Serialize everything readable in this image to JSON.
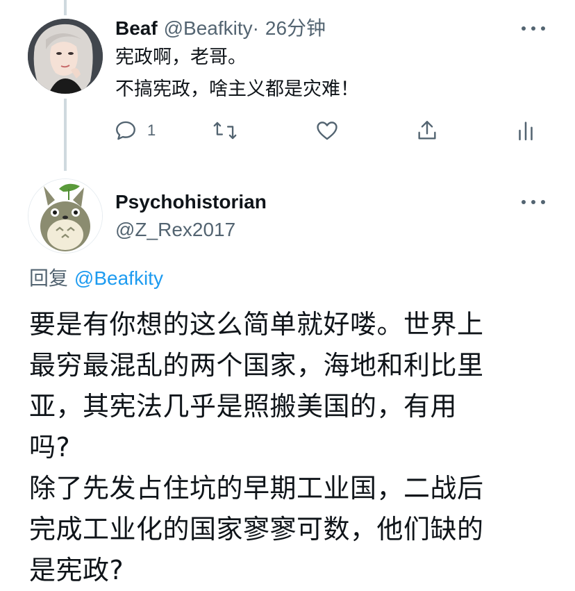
{
  "reply_tweet": {
    "name": "Beaf",
    "handle": "@Beafkity",
    "separator": "·",
    "time": "26分钟",
    "lines": [
      "宪政啊，老哥。",
      "不搞宪政，啥主义都是灾难！"
    ],
    "reply_count": "1",
    "icons": [
      "reply-icon",
      "retweet-icon",
      "like-icon",
      "share-icon",
      "analytics-icon"
    ]
  },
  "main_tweet": {
    "name": "Psychohistorian",
    "handle": "@Z_Rex2017",
    "reply_to_label": "回复",
    "reply_to_handle": "@Beafkity",
    "body_lines": [
      "要是有你想的这么简单就好喽。世界上",
      "最穷最混乱的两个国家，海地和利比里",
      "亚，其宪法几乎是照搬美国的，有用",
      "吗?",
      "除了先发占住坑的早期工业国，二战后",
      "完成工业化的国家寥寥可数，他们缺的",
      "是宪政?"
    ]
  },
  "colors": {
    "text": "#0f1419",
    "secondary": "#536471",
    "link": "#1d9bf0",
    "thread_line": "#cfd9de"
  }
}
